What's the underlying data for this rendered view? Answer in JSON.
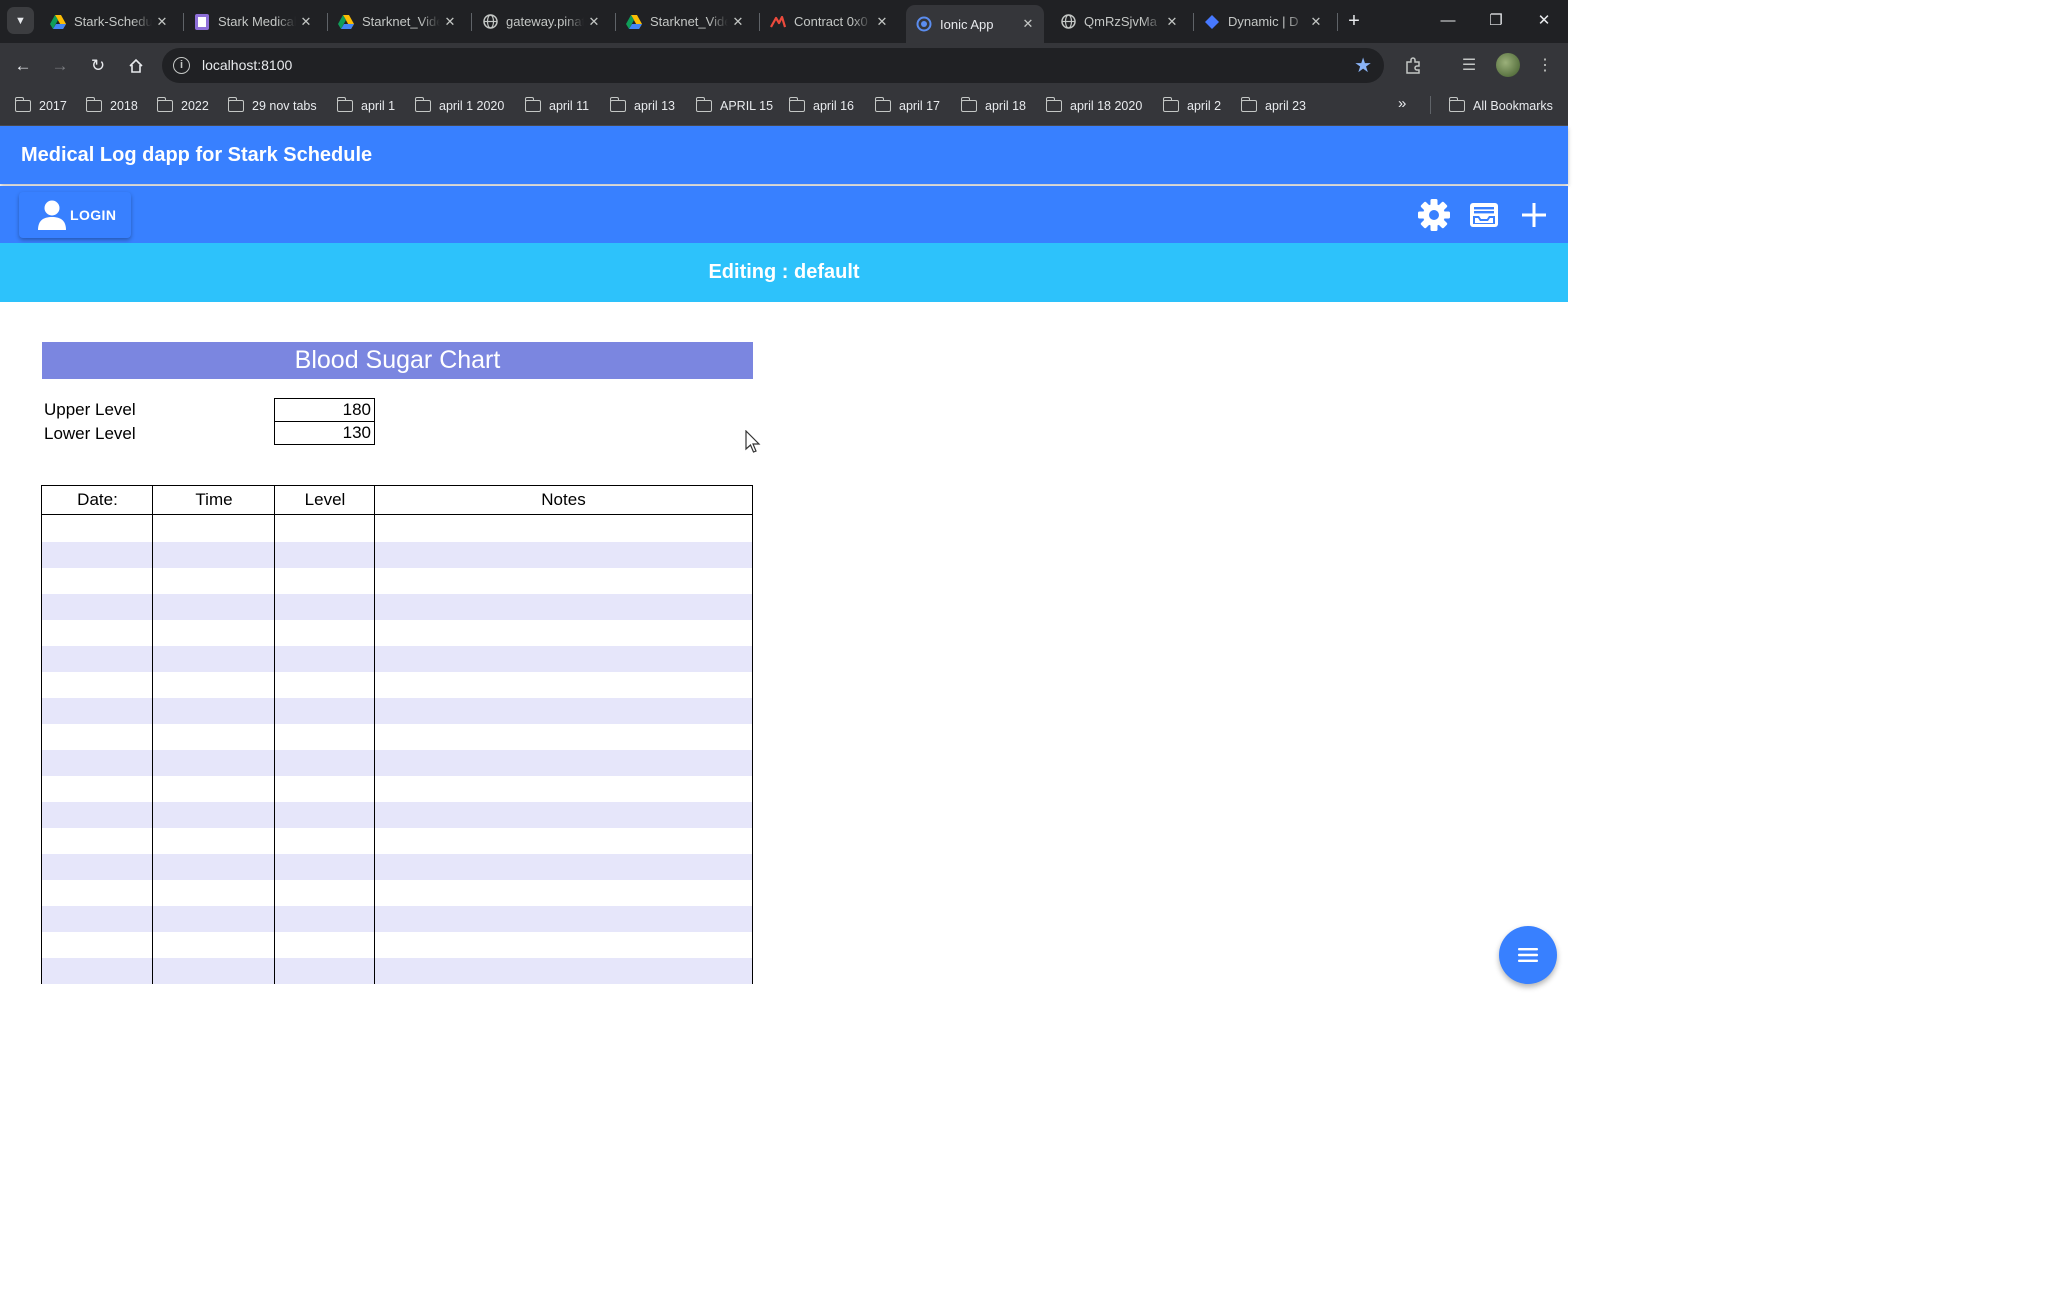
{
  "browser": {
    "tabs": [
      {
        "title": "Stark-Schedule",
        "icon": "google-drive-icon",
        "active": false
      },
      {
        "title": "Stark Medical",
        "icon": "purple-doc-icon",
        "active": false
      },
      {
        "title": "Starknet_Video",
        "icon": "google-drive-icon",
        "active": false
      },
      {
        "title": "gateway.pinata",
        "icon": "globe-icon",
        "active": false
      },
      {
        "title": "Starknet_Video",
        "icon": "google-drive-icon",
        "active": false
      },
      {
        "title": "Contract 0x0",
        "icon": "starknet-icon",
        "active": false
      },
      {
        "title": "Ionic App",
        "icon": "ionic-icon",
        "active": true
      },
      {
        "title": "QmRzSjvMa",
        "icon": "globe-icon",
        "active": false
      },
      {
        "title": "Dynamic | D",
        "icon": "dynamic-icon",
        "active": false
      }
    ],
    "address": "localhost:8100",
    "bookmarks": [
      "2017",
      "2018",
      "2022",
      "29 nov tabs",
      "april 1",
      "april 1 2020",
      "april 11",
      "april 13",
      "APRIL 15",
      "april 16",
      "april 17",
      "april 18",
      "april 18 2020",
      "april 2",
      "april 23"
    ],
    "all_bookmarks": "All Bookmarks"
  },
  "app": {
    "title": "Medical Log dapp for Stark Schedule",
    "login_label": "LOGIN",
    "editing_text": "Editing : default",
    "accent": "#3880ff",
    "editing_color": "#2dc2fb"
  },
  "sheet": {
    "title": "Blood Sugar Chart",
    "upper_label": "Upper Level",
    "upper_value": "180",
    "lower_label": "Lower Level",
    "lower_value": "130",
    "columns": [
      "Date:",
      "Time",
      "Level",
      "Notes"
    ],
    "title_color": "#7b86e0",
    "stripe_color": "#e6e6fa"
  }
}
